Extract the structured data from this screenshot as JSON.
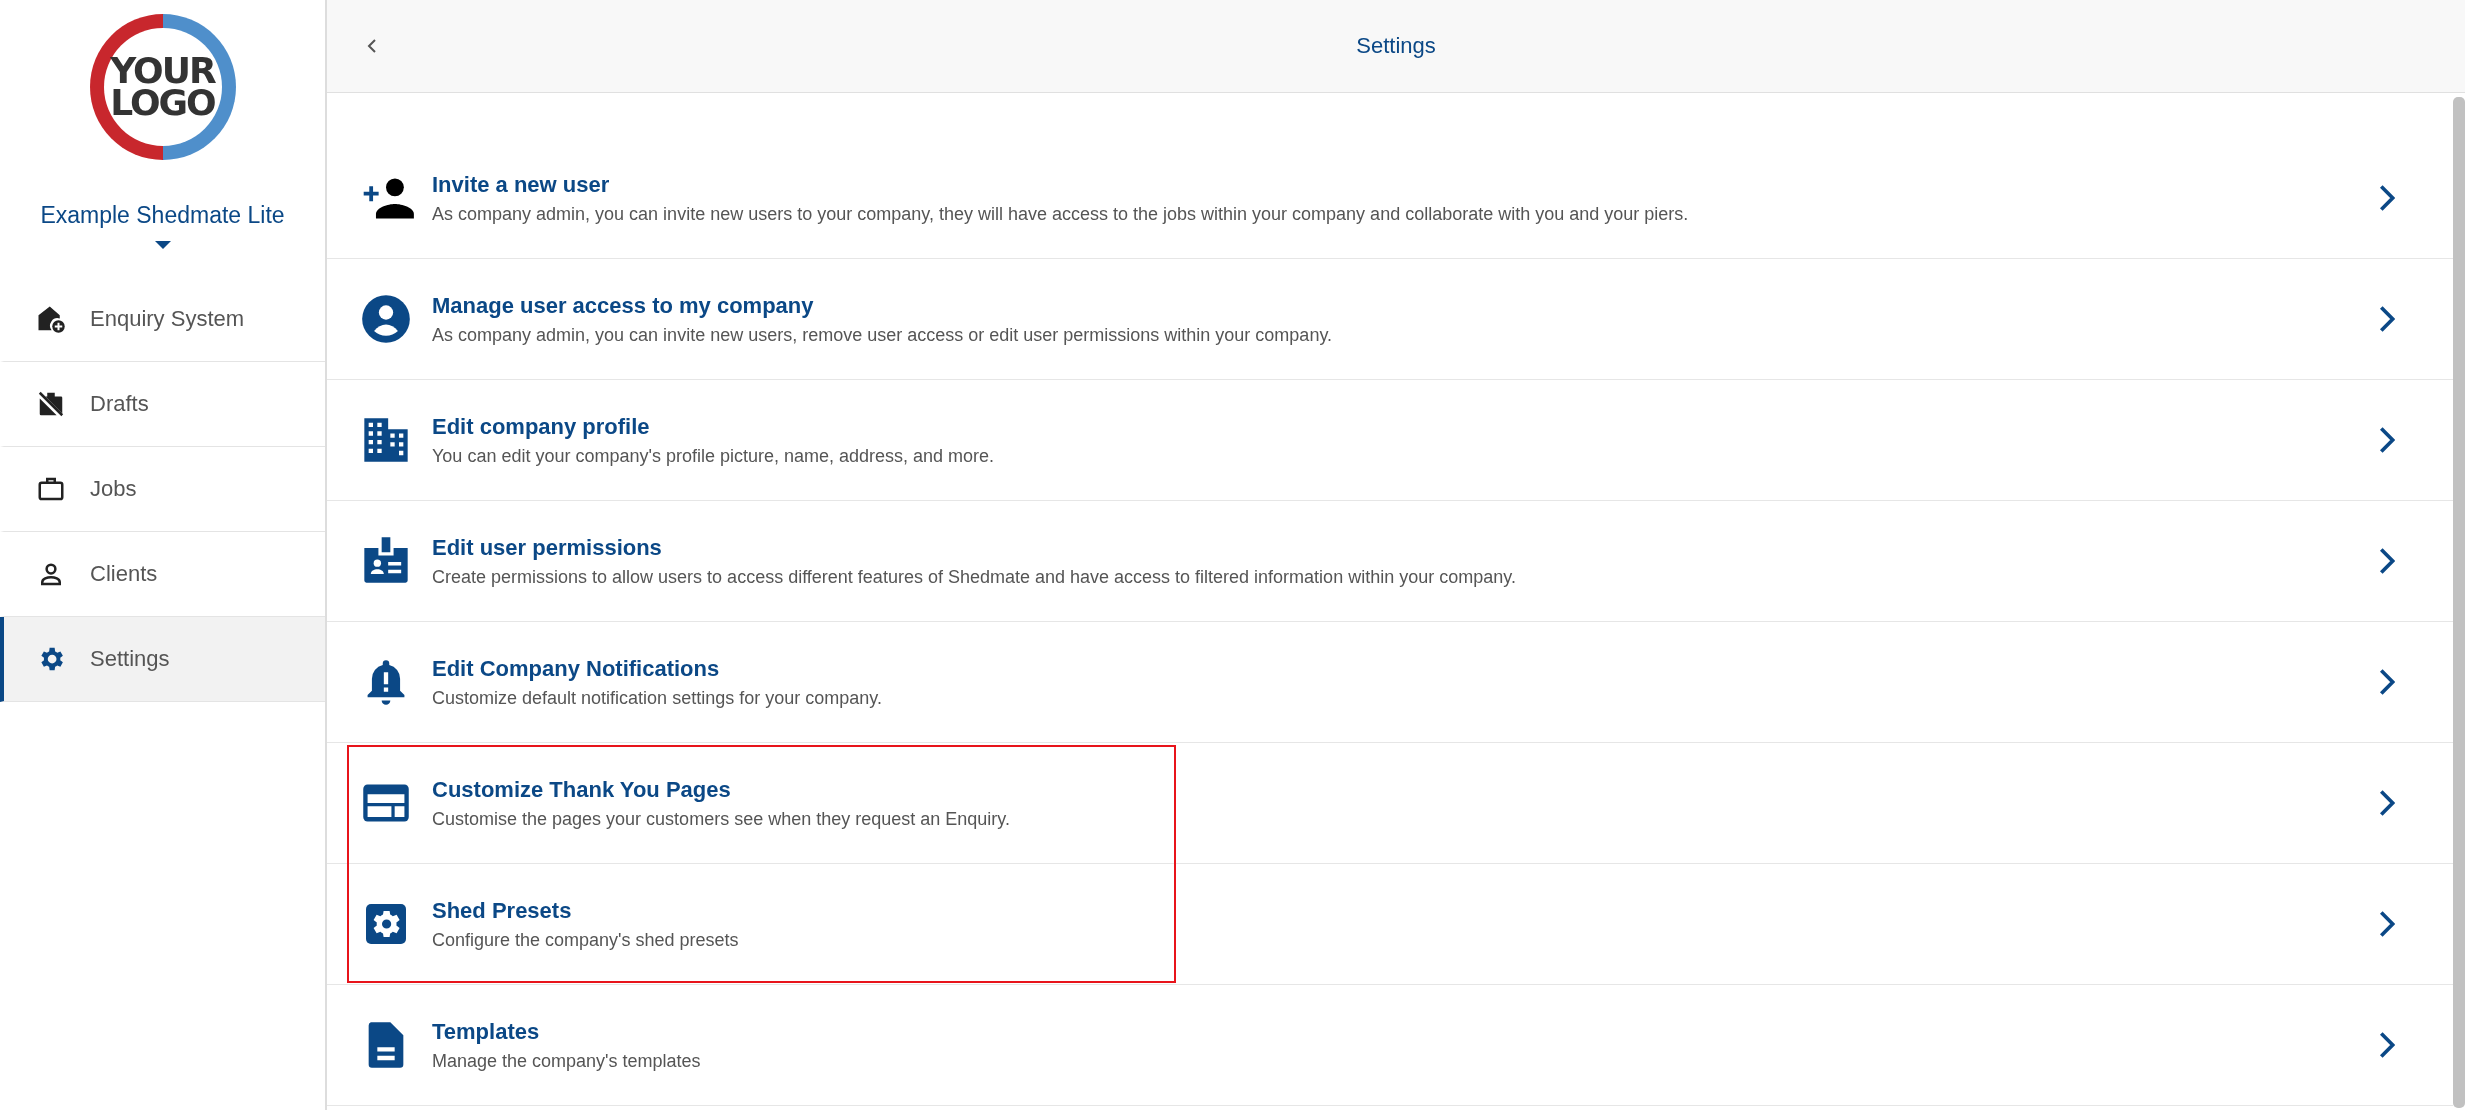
{
  "sidebar": {
    "logo": {
      "lines": [
        "YOUR",
        "LOGO"
      ]
    },
    "company": "Example Shedmate Lite",
    "items": [
      {
        "label": "Enquiry System",
        "selected": false
      },
      {
        "label": "Drafts",
        "selected": false
      },
      {
        "label": "Jobs",
        "selected": false
      },
      {
        "label": "Clients",
        "selected": false
      },
      {
        "label": "Settings",
        "selected": true
      }
    ]
  },
  "header": {
    "title": "Settings"
  },
  "rows": [
    {
      "title": "Invite a new user",
      "description": "As company admin, you can invite new users to your company, they will have access to the jobs within your company and collaborate with you and your piers.",
      "highlighted": false
    },
    {
      "title": "Manage user access to my company",
      "description": "As company admin, you can invite new users, remove user access or edit user permissions within your company.",
      "highlighted": false
    },
    {
      "title": "Edit company profile",
      "description": "You can edit your company's profile picture, name, address, and more.",
      "highlighted": false
    },
    {
      "title": "Edit user permissions",
      "description": "Create permissions to allow users to access different features of Shedmate and have access to filtered information within your company.",
      "highlighted": false
    },
    {
      "title": "Edit Company Notifications",
      "description": "Customize default notification settings for your company.",
      "highlighted": false
    },
    {
      "title": "Customize Thank You Pages",
      "description": "Customise the pages your customers see when they request an Enquiry.",
      "highlighted": true
    },
    {
      "title": "Shed Presets",
      "description": "Configure the company's shed presets",
      "highlighted": true
    },
    {
      "title": "Templates",
      "description": "Manage the company's templates",
      "highlighted": false
    }
  ]
}
